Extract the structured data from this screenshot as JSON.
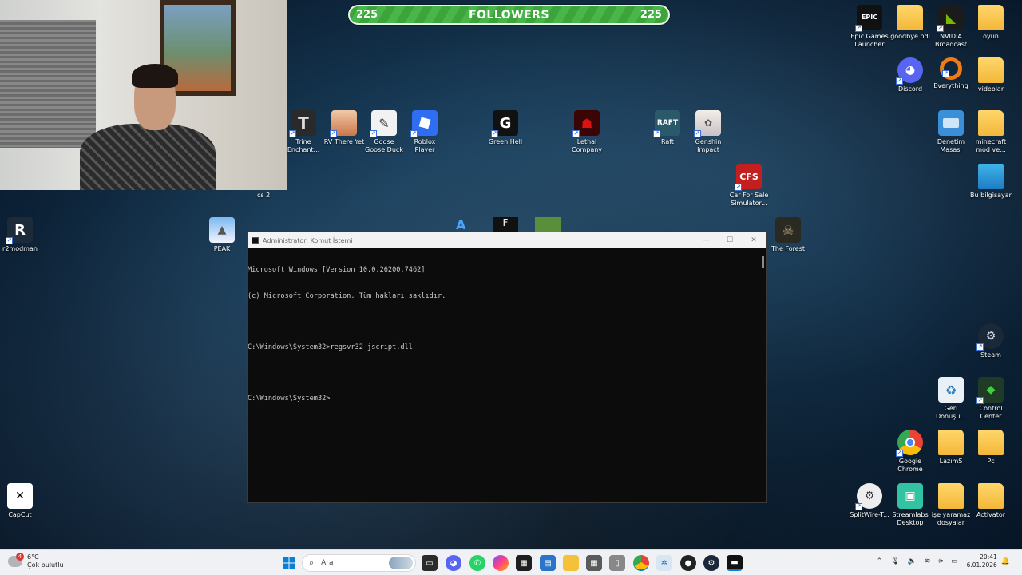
{
  "followers": {
    "left": "225",
    "label": "FOLLOWERS",
    "right": "225"
  },
  "webcam": {
    "caption": "cs 2"
  },
  "desktop_icons": {
    "epic": "Epic Games Launcher",
    "goodbye": "goodbye pdi",
    "nvidia": "NVIDIA Broadcast",
    "oyun": "oyun",
    "discord": "Discord",
    "everything": "Everything",
    "videolar": "videolar",
    "trine": "Trine Enchant...",
    "rv": "RV There Yet",
    "goose": "Goose Goose Duck",
    "roblox": "Roblox Player",
    "greenhell": "Green Hell",
    "lethal": "Lethal Company",
    "raft": "Raft",
    "genshin": "Genshin Impact",
    "denetim": "Denetim Masası",
    "minecraft": "minecraft mod ve...",
    "cfs": "Car For Sale Simulator...",
    "bubilgisayar": "Bu bilgisayar",
    "r2modman": "r2modman",
    "peak": "PEAK",
    "theforest": "The Forest",
    "steam": "Steam",
    "geri": "Geri Dönüşü...",
    "control": "Control Center",
    "chrome": "Google Chrome",
    "lazims": "LazımS",
    "pc": "Pc",
    "capcut": "CapCut",
    "splitwire": "SplitWire-T...",
    "streamlabs": "Streamlabs Desktop",
    "ise": "işe yaramaz dosyalar",
    "activator": "Activator"
  },
  "cmd": {
    "title": "Administrator: Komut İstemi",
    "lines": [
      "Microsoft Windows [Version 10.0.26200.7462]",
      "(c) Microsoft Corporation. Tüm hakları saklıdır.",
      "",
      "C:\\Windows\\System32>regsvr32 jscript.dll",
      "",
      "C:\\Windows\\System32>"
    ]
  },
  "taskbar": {
    "weather_temp": "6°C",
    "weather_desc": "Çok bulutlu",
    "weather_badge": "4",
    "search_placeholder": "Ara",
    "time": "20:41",
    "date": "6.01.2026"
  }
}
